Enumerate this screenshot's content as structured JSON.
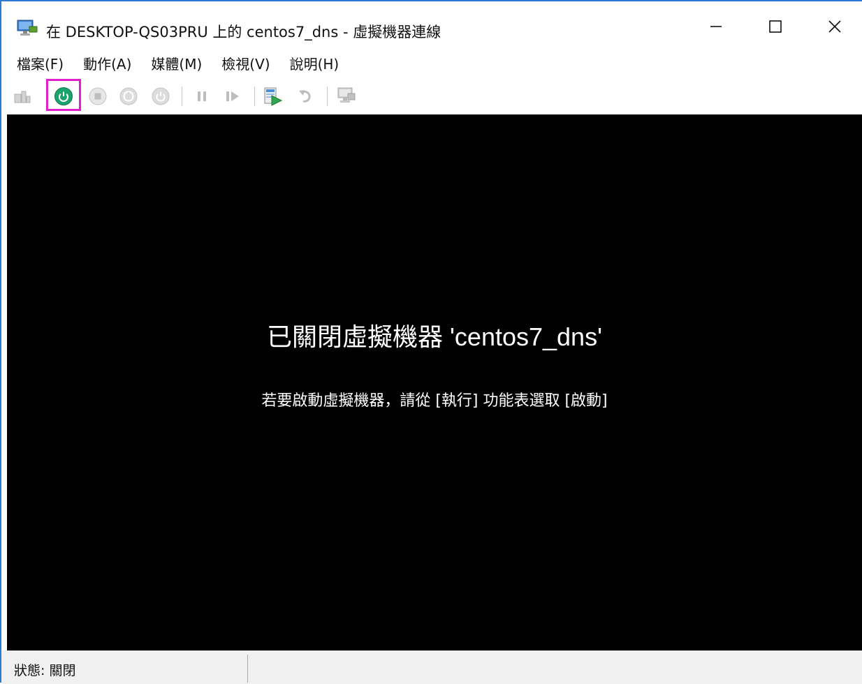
{
  "window": {
    "title": "在 DESKTOP-QS03PRU 上的 centos7_dns - 虛擬機器連線",
    "accent_color": "#2b7bd6",
    "controls": [
      "minimize-icon",
      "maximize-icon",
      "close-icon"
    ]
  },
  "menu": {
    "items": [
      {
        "label": "檔案(F)"
      },
      {
        "label": "動作(A)"
      },
      {
        "label": "媒體(M)"
      },
      {
        "label": "檢視(V)"
      },
      {
        "label": "說明(H)"
      }
    ]
  },
  "toolbar": {
    "buttons": [
      {
        "icon": "ctrl-alt-del-icon",
        "enabled": false
      },
      {
        "icon": "start-icon",
        "enabled": true,
        "highlighted": true,
        "color": "#1aa36a"
      },
      {
        "icon": "turn-off-icon",
        "enabled": false
      },
      {
        "icon": "shut-down-icon",
        "enabled": false
      },
      {
        "icon": "save-icon",
        "enabled": false
      },
      {
        "icon": "pause-icon",
        "enabled": false
      },
      {
        "icon": "resume-icon",
        "enabled": false
      },
      {
        "icon": "checkpoint-icon",
        "enabled": true
      },
      {
        "icon": "revert-icon",
        "enabled": false
      },
      {
        "icon": "enhanced-session-icon",
        "enabled": false
      }
    ],
    "highlight_color": "#e020c8"
  },
  "console": {
    "title": "已關閉虛擬機器 'centos7_dns'",
    "hint": "若要啟動虛擬機器，請從 [執行] 功能表選取 [啟動]",
    "background": "#000000"
  },
  "status": {
    "text": "狀態: 關閉"
  }
}
